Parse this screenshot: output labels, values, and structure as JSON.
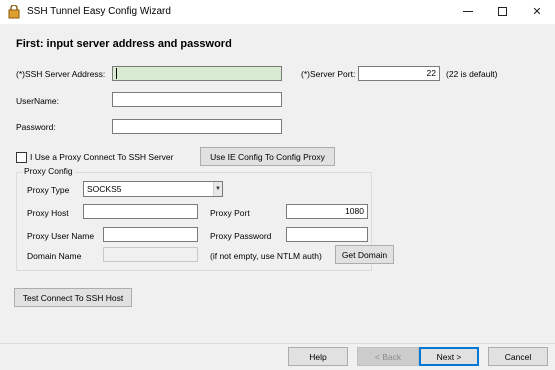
{
  "window": {
    "title": "SSH Tunnel Easy Config Wizard",
    "minimize_icon": "minimize-icon",
    "maximize_icon": "maximize-icon",
    "close_icon": "close-icon"
  },
  "heading": "First: input server address and password",
  "server": {
    "address_label": "(*)SSH Server Address:",
    "address_value": "",
    "port_label": "(*)Server Port:",
    "port_value": "22",
    "port_hint": "(22 is default)",
    "username_label": "UserName:",
    "username_value": "",
    "password_label": "Password:",
    "password_value": ""
  },
  "proxy": {
    "use_proxy_label": "I Use a Proxy Connect To SSH Server",
    "use_proxy_checked": false,
    "ie_config_button": "Use IE Config To Config Proxy",
    "group_title": "Proxy Config",
    "type_label": "Proxy Type",
    "type_selected": "SOCKS5",
    "host_label": "Proxy Host",
    "host_value": "",
    "port_label": "Proxy Port",
    "port_value": "1080",
    "user_label": "Proxy User Name",
    "user_value": "",
    "password_label": "Proxy Password",
    "password_value": "",
    "domain_label": "Domain Name",
    "domain_value": "",
    "domain_hint": "(if not empty, use NTLM auth)",
    "get_domain_button": "Get Domain"
  },
  "test_button": "Test Connect To SSH Host",
  "footer": {
    "help": "Help",
    "back": "< Back",
    "next": "Next >",
    "cancel": "Cancel"
  },
  "colors": {
    "focused_field": "#d9ecd3",
    "dialog_bg": "#f0f0f0",
    "primary_border": "#0078d7"
  }
}
